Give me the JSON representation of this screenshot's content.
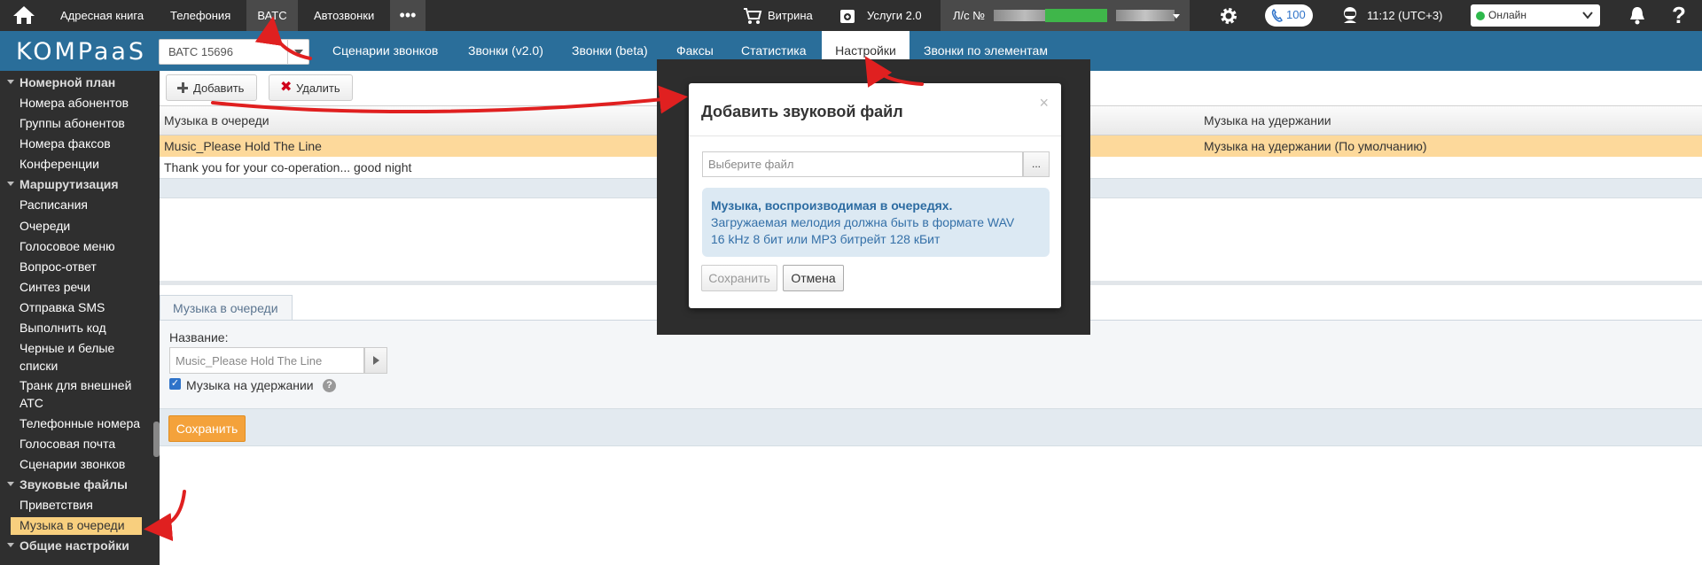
{
  "topbar": {
    "items": [
      "Адресная книга",
      "Телефония",
      "ВАТС",
      "Автозвонки"
    ],
    "storefront": "Витрина",
    "services": "Услуги 2.0",
    "account_prefix": "Л/с №",
    "calls_count": "100",
    "time": "11:12 (UTC+3)",
    "status": "Онлайн",
    "status_color": "#2db84b",
    "icons": [
      "home-icon",
      "more-icon",
      "cart-icon",
      "services-icon",
      "settings-icon",
      "phone-icon",
      "operator-icon",
      "bell-icon",
      "help-icon"
    ]
  },
  "brand": {
    "logo": "KOMPaaS"
  },
  "navbar": {
    "atc_select": "ВАТС 15696",
    "tabs": [
      "Сценарии звонков",
      "Звонки (v2.0)",
      "Звонки (beta)",
      "Факсы",
      "Статистика",
      "Настройки",
      "Звонки по элементам"
    ],
    "active_tab": "Настройки"
  },
  "sidebar": {
    "groups": [
      {
        "title": "Номерной план",
        "items": [
          "Номера абонентов",
          "Группы абонентов",
          "Номера факсов",
          "Конференции"
        ]
      },
      {
        "title": "Маршрутизация",
        "items": [
          "Расписания",
          "Очереди",
          "Голосовое меню",
          "Вопрос-ответ",
          "Синтез речи",
          "Отправка SMS",
          "Выполнить код",
          "Черные и белые",
          "списки",
          "Транк для внешней",
          "АТС",
          "Телефонные номера",
          "Голосовая почта",
          "Сценарии звонков"
        ]
      },
      {
        "title": "Звуковые файлы",
        "items": [
          "Приветствия",
          "Музыка в очереди"
        ]
      },
      {
        "title": "Общие настройки",
        "items": []
      }
    ],
    "active_item": "Музыка в очереди"
  },
  "toolbar": {
    "add_label": "Добавить",
    "delete_label": "Удалить"
  },
  "grid": {
    "columns": [
      "Музыка в очереди",
      "Музыка на удержании"
    ],
    "rows": [
      [
        "Music_Please Hold The Line",
        "Музыка на удержании (По умолчанию)"
      ],
      [
        "Thank you for your co-operation... good night",
        ""
      ]
    ]
  },
  "detail": {
    "tab_label": "Музыка в очереди",
    "name_label": "Название:",
    "name_value": "Music_Please Hold The Line",
    "hold_label": "Музыка на удержании",
    "hold_checked": true,
    "save_label": "Сохранить"
  },
  "modal": {
    "title": "Добавить звуковой файл",
    "file_placeholder": "Выберите файл",
    "browse_label": "...",
    "info_title": "Музыка, воспроизводимая в очередях.",
    "info_line1": "Загружаемая мелодия должна быть в формате WAV",
    "info_line2": "16 kHz 8 бит или MP3 битрейт 128 кБит",
    "save_label": "Сохранить",
    "cancel_label": "Отмена"
  },
  "colors": {
    "brand_blue": "#2a6e9a",
    "dark": "#2f2f2f",
    "highlight": "#fdd99b",
    "orange": "#f4a23b",
    "arrow_red": "#e02020"
  }
}
